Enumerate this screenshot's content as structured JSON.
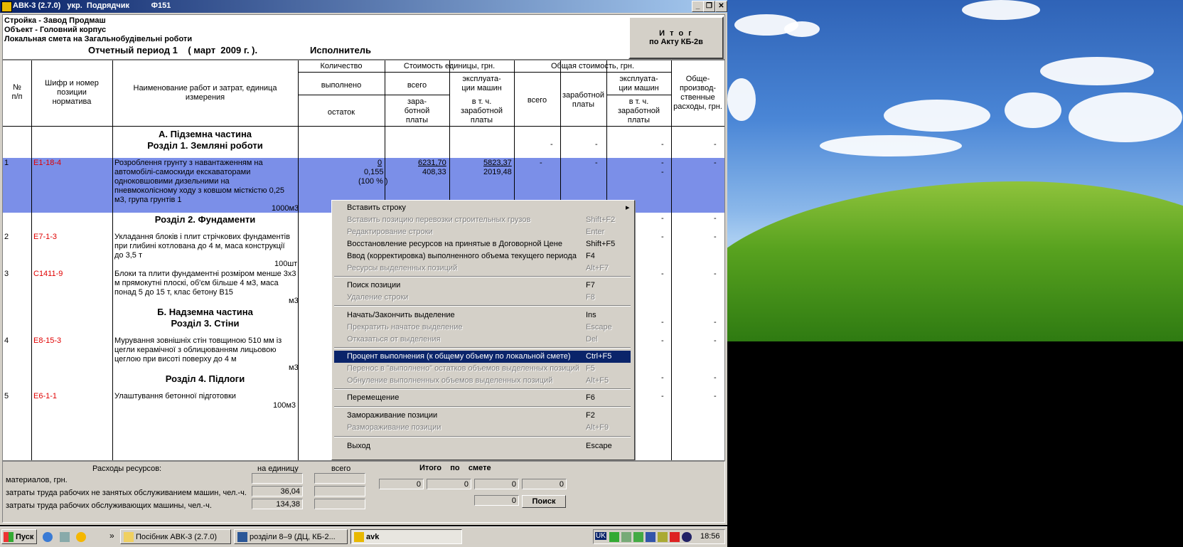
{
  "window": {
    "title": "АВК-3 (2.7.0)   укр.  Подрядчик          Ф151",
    "btn_min": "_",
    "btn_max": "❐",
    "btn_close": "✕"
  },
  "header": {
    "line1": "Стройка - Завод Продмаш",
    "line2": "Объект - Головний корпус",
    "line3": "Локальная смета на Загальнобудівельні роботи",
    "period": "Отчетный период 1    ( март  2009 г. ).",
    "executor": "Исполнитель",
    "itog_line1": "И т о г",
    "itog_line2": "по Акту КБ-2в"
  },
  "columns": {
    "num": "№\nп/п",
    "code": "Шифр и номер\nпозиции\nнорматива",
    "name": "Наименование работ и затрат, единица\nизмерения",
    "qty": "Количество",
    "qty_done": "выполнено",
    "qty_rest": "остаток",
    "unit_cost": "Стоимость единицы, грн.",
    "unit_all": "всего",
    "unit_mach": "эксплуата-\nции машин",
    "unit_wage": "зара-\nботной\nплаты",
    "unit_mach_wage": "в т. ч.\nзаработной\nплаты",
    "total_cost": "Общая стоимость, грн.",
    "total_all": "всего",
    "total_wage": "заработной\nплаты",
    "total_mach": "эксплуата-\nции машин",
    "total_mach_wage": "в т. ч.\nзаработной\nплаты",
    "overhead": "Обще-\nпроизвод-\nственные\nрасходы, грн."
  },
  "sections": {
    "a_title": "А.   Підземна частина",
    "s1": "Розділ 1. Земляні роботи",
    "s2": "Розділ 2. Фундаменти",
    "b_title": "Б.   Надземна частина",
    "s3": "Розділ 3. Стіни",
    "s4": "Розділ 4. Підлоги"
  },
  "rows": [
    {
      "num": "1",
      "code": "Е1-18-4",
      "name": "Розроблення грунту з навантаженням на\nавтомобілі-самоскиди екскаваторами\nодноковшовими дизельними на\nпневмоколісному ходу з ковшом місткістю 0,25\nм3, група грунтів 1",
      "unit": "1000м3",
      "qty_done": "0",
      "qty_rest": "0,155",
      "qty_pct": "(100 % )",
      "unit_all": "6231,70",
      "unit_wage": "408,33",
      "unit_mach": "5823,37",
      "unit_mach_wage": "2019,48",
      "dash": "-"
    },
    {
      "num": "2",
      "code": "Е7-1-3",
      "name": "Укладання блоків і плит стрічкових фундаментів\nпри глибині котлована до 4 м, маса конструкції\nдо 3,5 т",
      "unit": "100шт"
    },
    {
      "num": "3",
      "code": "С1411-9",
      "name": "Блоки та плити фундаментні розміром менше 3х3\nм прямокутні плоскі, об'єм більше 4 м3, маса\nпонад 5 до 15 т, клас бетону В15",
      "unit": "м3"
    },
    {
      "num": "4",
      "code": "Е8-15-3",
      "name": "Мурування зовнішніх стін товщиною 510 мм із\nцегли керамічної з облицюванням лицьовою\nцеглою при висоті поверху до 4 м",
      "unit": "м3"
    },
    {
      "num": "5",
      "code": "Е6-1-1",
      "name": "Улаштування бетонної підготовки",
      "unit": "100м3"
    }
  ],
  "menu": [
    {
      "label": "Вставить строку",
      "shortcut": "",
      "disabled": false,
      "submenu": true
    },
    {
      "label": "Вставить позицию перевозки строительных грузов",
      "shortcut": "Shift+F2",
      "disabled": true
    },
    {
      "label": "Редактирование строки",
      "shortcut": "Enter",
      "disabled": true
    },
    {
      "label": "Восстановление ресурсов на принятые в Договорной Цене",
      "shortcut": "Shift+F5",
      "disabled": false
    },
    {
      "label": "Ввод (корректировка) выполненного объема текущего периода",
      "shortcut": "F4",
      "disabled": false
    },
    {
      "label": "Ресурсы выделенных позиций",
      "shortcut": "Alt+F7",
      "disabled": true
    },
    {
      "label": "Поиск позиции",
      "shortcut": "F7",
      "disabled": false
    },
    {
      "label": "Удаление строки",
      "shortcut": "F8",
      "disabled": true
    },
    {
      "label": "Начать/Закончить выделение",
      "shortcut": "Ins",
      "disabled": false
    },
    {
      "label": "Прекратить начатое выделение",
      "shortcut": "Escape",
      "disabled": true
    },
    {
      "label": "Отказаться от выделения",
      "shortcut": "Del",
      "disabled": true
    },
    {
      "label": "Процент выполнения (к общему объему по локальной смете)",
      "shortcut": "Ctrl+F5",
      "disabled": false,
      "highlighted": true
    },
    {
      "label": "Перенос в \"выполнено\" остатков объемов  выделенных позиций",
      "shortcut": "F5",
      "disabled": true
    },
    {
      "label": "Обнуление выполненных объемов выделенных позиций",
      "shortcut": "Alt+F5",
      "disabled": true
    },
    {
      "label": "Перемещение",
      "shortcut": "F6",
      "disabled": false
    },
    {
      "label": "Замораживание позиции",
      "shortcut": "F2",
      "disabled": false
    },
    {
      "label": "Размораживание позиции",
      "shortcut": "Alt+F9",
      "disabled": true
    },
    {
      "label": "Выход",
      "shortcut": "Escape",
      "disabled": false
    }
  ],
  "bottom": {
    "res_title": "Расходы ресурсов:",
    "per_unit": "на единицу",
    "total": "всего",
    "itogo": "Итого    по    смете",
    "materials": "материалов, грн.",
    "labor_not_mach": "затраты труда рабочих не занятых обслуживанием машин, чел.-ч.",
    "labor_mach": "затраты труда рабочих обслуживающих машины, чел.-ч.",
    "v_not_mach": "36,04",
    "v_mach": "134,38",
    "z1": "0",
    "z2": "0",
    "z3": "0",
    "z4": "0",
    "z5": "0",
    "search_btn": "Поиск"
  },
  "taskbar": {
    "start": "Пуск",
    "chev": "»",
    "task1": "Посібник АВК-3 (2.7.0)",
    "task2": "розділи 8–9 (ДЦ, КБ-2...",
    "task3": "avk",
    "lang": "UK",
    "clock": "18:56"
  }
}
